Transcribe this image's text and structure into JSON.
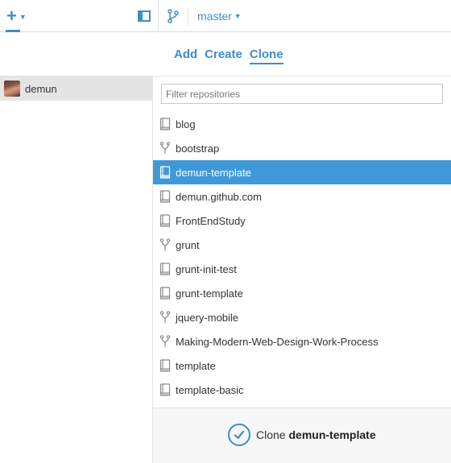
{
  "toolbar": {
    "add_icon": "plus-icon",
    "add_caret_icon": "caret-down-icon",
    "sidebar_icon": "sidebar-toggle-icon",
    "branch_icon": "branch-icon",
    "branch_name": "master"
  },
  "tabs": [
    {
      "label": "Add",
      "active": false
    },
    {
      "label": "Create",
      "active": false
    },
    {
      "label": "Clone",
      "active": true
    }
  ],
  "account": {
    "name": "demun",
    "avatar": "avatar-photo"
  },
  "filter": {
    "placeholder": "Filter repositories",
    "value": ""
  },
  "repos": [
    {
      "name": "blog",
      "type": "repo-icon"
    },
    {
      "name": "bootstrap",
      "type": "fork-icon"
    },
    {
      "name": "demun-template",
      "type": "repo-icon",
      "selected": true
    },
    {
      "name": "demun.github.com",
      "type": "repo-icon"
    },
    {
      "name": "FrontEndStudy",
      "type": "repo-icon"
    },
    {
      "name": "grunt",
      "type": "fork-icon"
    },
    {
      "name": "grunt-init-test",
      "type": "repo-icon"
    },
    {
      "name": "grunt-template",
      "type": "repo-icon"
    },
    {
      "name": "jquery-mobile",
      "type": "fork-icon"
    },
    {
      "name": "Making-Modern-Web-Design-Work-Process",
      "type": "fork-icon"
    },
    {
      "name": "template",
      "type": "repo-icon"
    },
    {
      "name": "template-basic",
      "type": "repo-icon"
    }
  ],
  "clone": {
    "label": "Clone",
    "repo": "demun-template",
    "icon": "check-circle-icon"
  },
  "colors": {
    "accent": "#3f8dcb",
    "selected_row": "#3f98d7",
    "account_bg": "#e5e5e5"
  }
}
